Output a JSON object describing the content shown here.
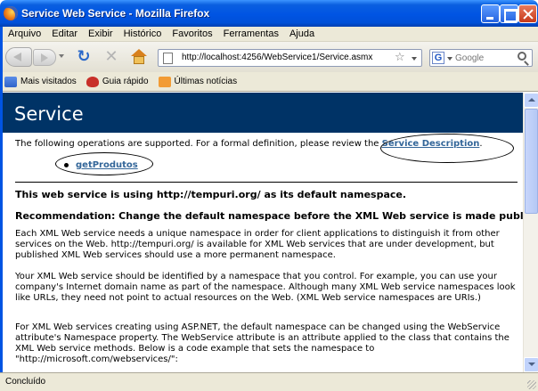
{
  "window": {
    "title": "Service Web Service - Mozilla Firefox"
  },
  "menu": [
    "Arquivo",
    "Editar",
    "Exibir",
    "Histórico",
    "Favoritos",
    "Ferramentas",
    "Ajuda"
  ],
  "toolbar": {
    "url": "http://localhost:4256/WebService1/Service.asmx",
    "search_placeholder": "Google"
  },
  "bookmarks": [
    {
      "label": "Mais visitados",
      "icon": "folder-icon"
    },
    {
      "label": "Guia rápido",
      "icon": "bug-icon"
    },
    {
      "label": "Últimas notícias",
      "icon": "feed-icon"
    }
  ],
  "page": {
    "heading": "Service",
    "ops_intro": "The following operations are supported. For a formal definition, please review the ",
    "service_description_link": "Service Description",
    "ops_intro_end": ".",
    "operations": [
      "getProdutos"
    ],
    "ns_heading": "This web service is using http://tempuri.org/ as its default namespace.",
    "rec_heading": "Recommendation: Change the default namespace before the XML Web service is made public.",
    "para1": "Each XML Web service needs a unique namespace in order for client applications to distinguish it from other services on the Web. http://tempuri.org/ is available for XML Web services that are under development, but published XML Web services should use a more permanent namespace.",
    "para2": "Your XML Web service should be identified by a namespace that you control. For example, you can use your company's Internet domain name as part of the namespace. Although many XML Web service namespaces look like URLs, they need not point to actual resources on the Web. (XML Web service namespaces are URIs.)",
    "para3": "For XML Web services creating using ASP.NET, the default namespace can be changed using the WebService attribute's Namespace property. The WebService attribute is an attribute applied to the class that contains the XML Web service methods. Below is a code example that sets the namespace to \"http://microsoft.com/webservices/\":"
  },
  "status": {
    "text": "Concluído"
  },
  "colors": {
    "banner": "#003366",
    "link": "#336699",
    "titlebar": "#0054e3"
  }
}
